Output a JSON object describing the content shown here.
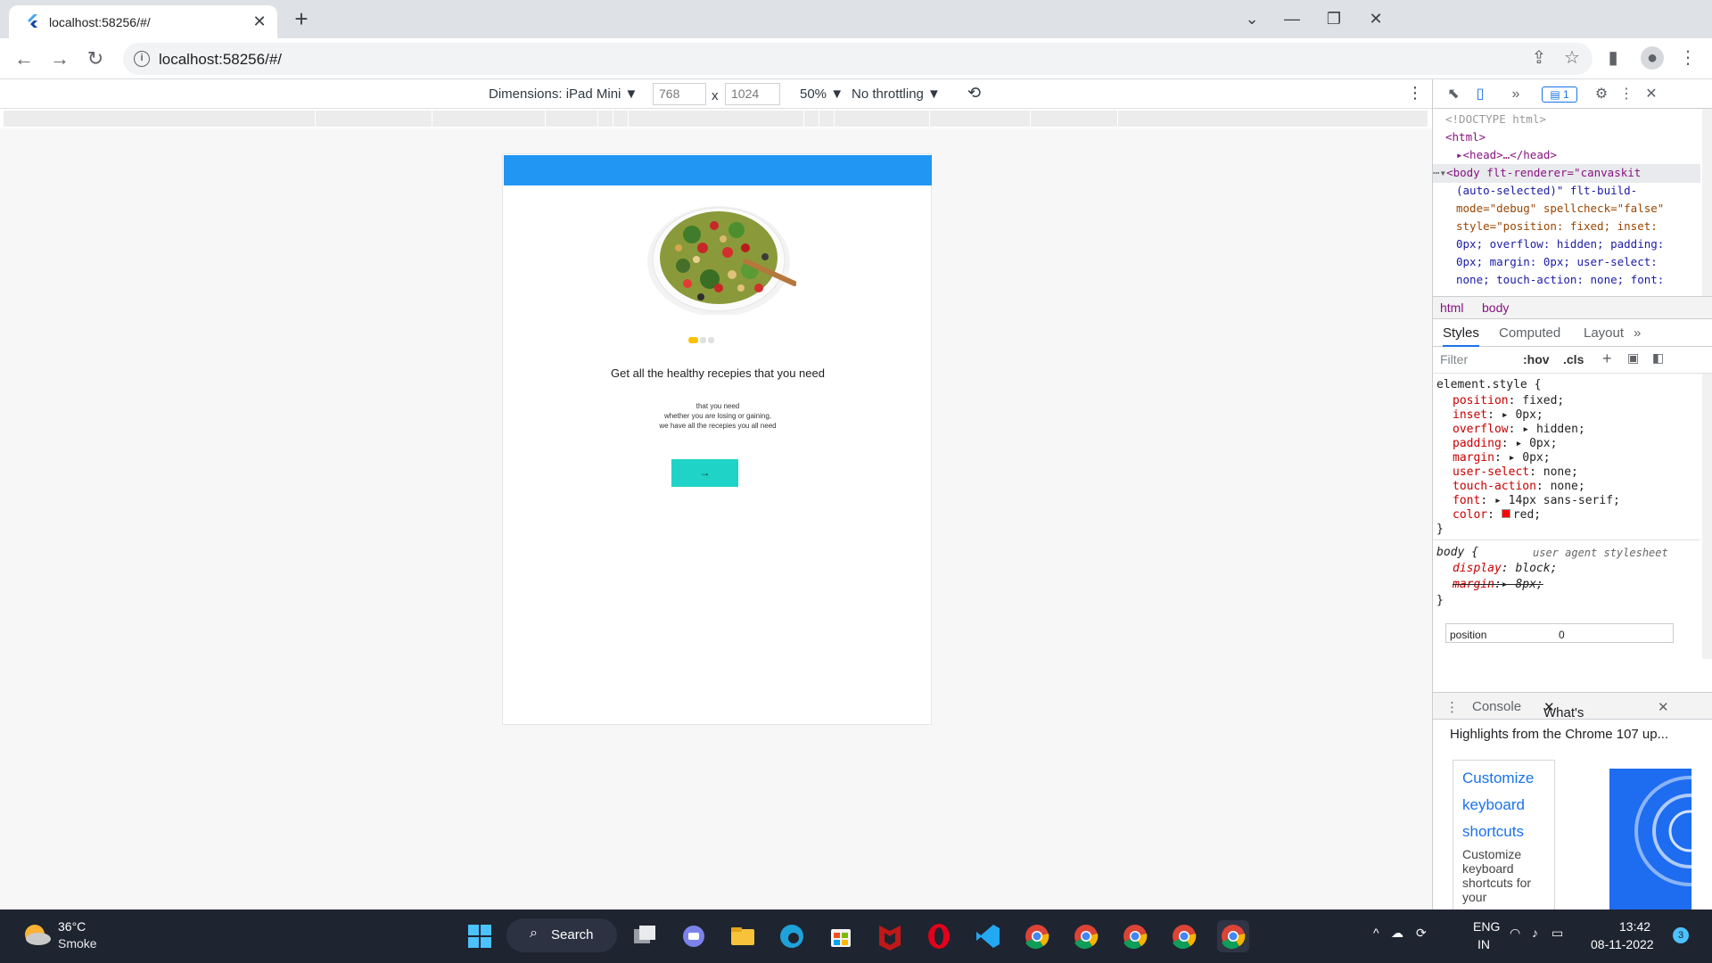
{
  "browser": {
    "tab_title": "localhost:58256/#/",
    "url": "localhost:58256/#/"
  },
  "device_toolbar": {
    "dimensions_label": "Dimensions: iPad Mini",
    "width": "768",
    "times": "x",
    "height": "1024",
    "zoom": "50%",
    "throttling": "No throttling"
  },
  "app": {
    "heading": "Get all the healthy recepies that you need",
    "sub_line1": "that you need",
    "sub_line2": "whether you are losing or gaining,",
    "sub_line3": "we have all the recepies you all need",
    "button_label": "→",
    "appbar_color": "#2196f3",
    "button_color": "#1fd3c6",
    "dot_active_color": "#ffc107"
  },
  "devtools": {
    "issues_count": "1",
    "elements": {
      "doctype": "<!DOCTYPE html>",
      "html_open": "<html>",
      "head": "<head>…</head>",
      "body_line1": "<body flt-renderer=\"canvaskit",
      "body_line2": "(auto-selected)\" flt-build-",
      "body_line3": "mode=\"debug\" spellcheck=\"false\"",
      "body_line4": "style=\"position: fixed; inset:",
      "body_line5": "0px; overflow: hidden; padding:",
      "body_line6": "0px; margin: 0px; user-select:",
      "body_line7": "none; touch-action: none; font:"
    },
    "breadcrumbs": [
      "html",
      "body"
    ],
    "style_tabs": [
      "Styles",
      "Computed",
      "Layout"
    ],
    "filter_placeholder": "Filter",
    "hov": ":hov",
    "cls": ".cls",
    "styles": {
      "element_style": "element.style {",
      "rules": [
        {
          "prop": "position",
          "val": "fixed;"
        },
        {
          "prop": "inset",
          "val": "0px;"
        },
        {
          "prop": "overflow",
          "val": "hidden;"
        },
        {
          "prop": "padding",
          "val": "0px;"
        },
        {
          "prop": "margin",
          "val": "0px;"
        },
        {
          "prop": "user-select",
          "val": "none;"
        },
        {
          "prop": "touch-action",
          "val": "none;"
        },
        {
          "prop": "font",
          "val": "14px sans-serif;"
        },
        {
          "prop": "color",
          "val": "red;"
        }
      ],
      "close": "}",
      "body_selector": "body {",
      "ua_label": "user agent stylesheet",
      "display_prop": "display",
      "display_val": "block;",
      "margin_prop": "margin",
      "margin_val": "8px;"
    },
    "computed_prop": "position",
    "computed_val": "0",
    "drawer_tabs": [
      "Console",
      "What's New"
    ],
    "whats_new": {
      "title": "Highlights from the Chrome 107 up...",
      "card_title_lines": [
        "Customize",
        "keyboard",
        "shortcuts"
      ],
      "card_text_lines": [
        "Customize",
        "keyboard",
        "shortcuts for",
        "your"
      ]
    }
  },
  "taskbar": {
    "temperature": "36°C",
    "condition": "Smoke",
    "search_label": "Search",
    "language": "ENG",
    "region": "IN",
    "time": "13:42",
    "date": "08-11-2022",
    "notification_count": "3"
  }
}
